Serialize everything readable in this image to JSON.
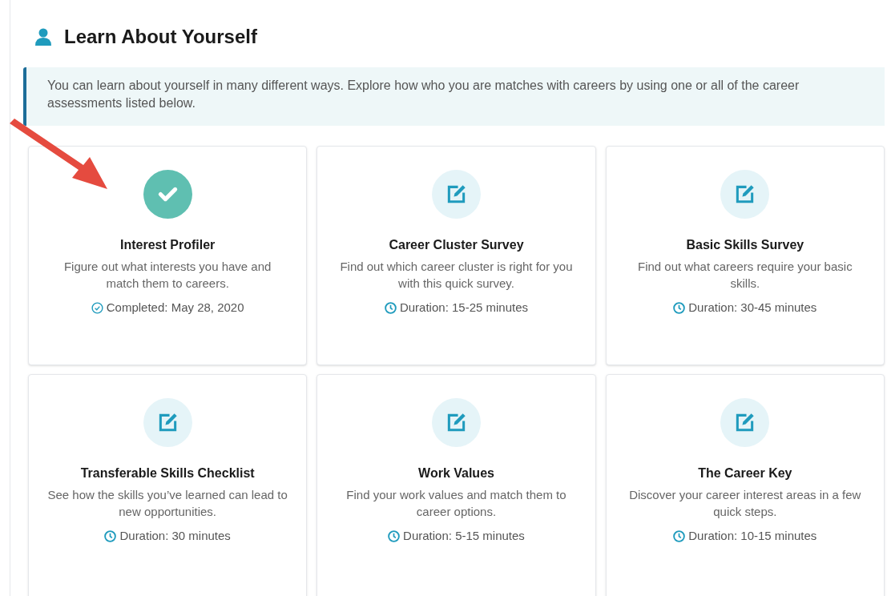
{
  "heading": "Learn About Yourself",
  "intro": "You can learn about yourself in many different ways. Explore how who you are matches with careers by using one or all of the career assessments listed below.",
  "assessments": [
    {
      "kind": "completed",
      "title": "Interest Profiler",
      "description": "Figure out what interests you have and match them to careers.",
      "status": "Completed: May 28, 2020"
    },
    {
      "kind": "pending",
      "title": "Career Cluster Survey",
      "description": "Find out which career cluster is right for you with this quick survey.",
      "status": "Duration: 15-25 minutes"
    },
    {
      "kind": "pending",
      "title": "Basic Skills Survey",
      "description": "Find out what careers require your basic skills.",
      "status": "Duration: 30-45 minutes"
    },
    {
      "kind": "pending",
      "title": "Transferable Skills Checklist",
      "description": "See how the skills you’ve learned can lead to new opportunities.",
      "status": "Duration: 30 minutes"
    },
    {
      "kind": "pending",
      "title": "Work Values",
      "description": "Find your work values and match them to career options.",
      "status": "Duration: 5-15 minutes"
    },
    {
      "kind": "pending",
      "title": "The Career Key",
      "description": "Discover your career interest areas in a few quick steps.",
      "status": "Duration: 10-15 minutes"
    }
  ]
}
